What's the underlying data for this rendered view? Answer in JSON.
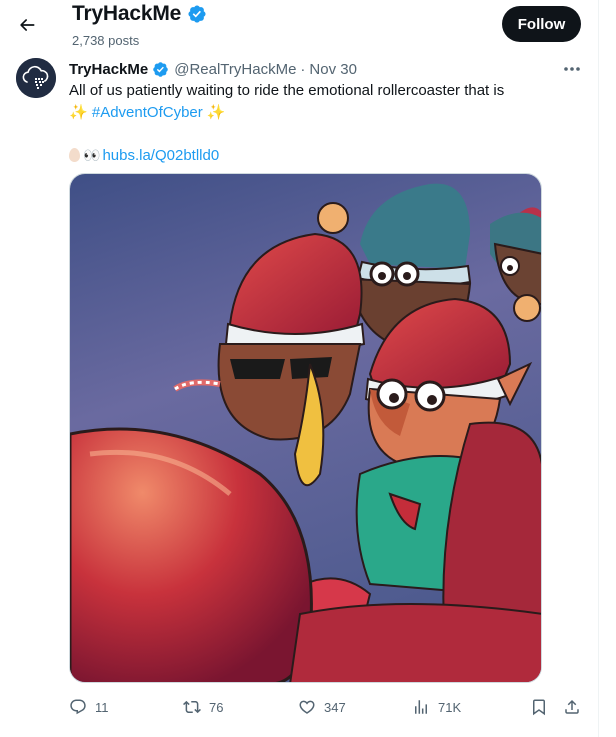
{
  "header": {
    "profile_name": "TryHackMe",
    "post_count": "2,738 posts",
    "follow_label": "Follow"
  },
  "tweet": {
    "author_name": "TryHackMe",
    "handle": "@RealTryHackMe",
    "separator": "·",
    "date": "Nov 30",
    "text_line1": "All of us patiently waiting to ride the emotional rollercoaster that is",
    "sparkle": "✨",
    "hashtag": "#AdventOfCyber",
    "link": "hubs.la/Q02btlld0",
    "media_icon": "elves-on-sleigh-illustration"
  },
  "actions": {
    "replies": "11",
    "reposts": "76",
    "likes": "347",
    "views": "71K"
  },
  "colors": {
    "accent": "#1d9bf0",
    "text": "#0f1419",
    "muted": "#536471",
    "follow_bg": "#0f1419"
  },
  "icons": [
    "back-arrow-icon",
    "verified-badge-icon",
    "more-options-icon",
    "reply-icon",
    "repost-icon",
    "like-icon",
    "views-icon",
    "bookmark-icon",
    "share-icon"
  ]
}
